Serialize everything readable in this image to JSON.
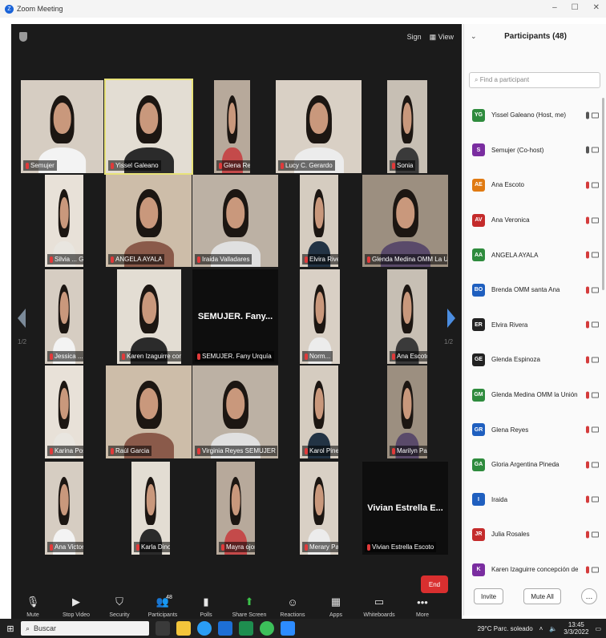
{
  "window": {
    "title": "Zoom Meeting"
  },
  "topbar": {
    "sign_label": "Sign",
    "view_label": "View"
  },
  "tiles": [
    {
      "label": "Semujer"
    },
    {
      "label": "Yissel Galeano"
    },
    {
      "label": "Glena Reyes"
    },
    {
      "label": "Lucy C. Gerardo"
    },
    {
      "label": "Sonia"
    },
    {
      "label": "Silvia ... G"
    },
    {
      "label": "ANGELA AYALA"
    },
    {
      "label": "Iraida Valladares"
    },
    {
      "label": "Elvira Rivera"
    },
    {
      "label": "Glenda Medina OMM La U..."
    },
    {
      "label": "Jessica ... Ana"
    },
    {
      "label": "Karen Izaguirre concepción d..."
    },
    {
      "label": "SEMUJER. Fany Urquía",
      "big_name": "SEMUJER. Fany..."
    },
    {
      "label": "Norm..."
    },
    {
      "label": "Ana Escoto"
    },
    {
      "label": "Karina Posadas"
    },
    {
      "label": "Raúl Garcia"
    },
    {
      "label": "Virginia Reyes SEMUJER"
    },
    {
      "label": "Karol Pineda"
    },
    {
      "label": "Marilyn Padilla"
    },
    {
      "label": "Ana Victoria"
    },
    {
      "label": "Karla Dinora Colindres"
    },
    {
      "label": "Mayra ojorto herrera"
    },
    {
      "label": "Merary Padilla"
    },
    {
      "label": "Vivian Estrella Escoto",
      "big_name": "Vivian Estrella E..."
    }
  ],
  "pager": {
    "left": "1/2",
    "right": "1/2"
  },
  "toolbar": {
    "items": [
      {
        "label": "Mute",
        "icon": "microphone-icon"
      },
      {
        "label": "Stop Video",
        "icon": "video-camera-icon"
      },
      {
        "label": "Security",
        "icon": "shield-icon"
      },
      {
        "label": "Participants",
        "icon": "participants-icon",
        "count": "48"
      },
      {
        "label": "Polls",
        "icon": "poll-icon"
      },
      {
        "label": "Share Screen",
        "icon": "share-screen-icon"
      },
      {
        "label": "Reactions",
        "icon": "reactions-icon"
      },
      {
        "label": "Apps",
        "icon": "apps-icon"
      },
      {
        "label": "Whiteboards",
        "icon": "whiteboard-icon"
      },
      {
        "label": "More",
        "icon": "more-icon"
      }
    ],
    "end_label": "End"
  },
  "panel": {
    "title": "Participants (48)",
    "search_placeholder": "Find a participant",
    "invite_label": "Invite",
    "mute_all_label": "Mute All",
    "participants": [
      {
        "initials": "YG",
        "name": "Yissel Galeano (Host, me)",
        "color": "#2e8b3d",
        "muted": false
      },
      {
        "initials": "S",
        "name": "Semujer (Co-host)",
        "color": "#7a2da0",
        "muted": false
      },
      {
        "initials": "AE",
        "name": "Ana Escoto",
        "color": "#e07a12",
        "muted": true
      },
      {
        "initials": "AV",
        "name": "Ana Veronica",
        "color": "#c42b2b",
        "muted": true
      },
      {
        "initials": "AA",
        "name": "ANGELA AYALA",
        "color": "#2e8b3d",
        "muted": true
      },
      {
        "initials": "BO",
        "name": "Brenda OMM santa Ana",
        "color": "#1f5fbf",
        "muted": true
      },
      {
        "initials": "ER",
        "name": "Elvira Rivera",
        "color": "#222222",
        "muted": true
      },
      {
        "initials": "GE",
        "name": "Glenda Espinoza",
        "color": "#222222",
        "muted": true
      },
      {
        "initials": "GM",
        "name": "Glenda Medina OMM la Unión",
        "color": "#2e8b3d",
        "muted": true
      },
      {
        "initials": "GR",
        "name": "Glena Reyes",
        "color": "#1f5fbf",
        "muted": true
      },
      {
        "initials": "GA",
        "name": "Gloria Argentina Pineda",
        "color": "#2e8b3d",
        "muted": true
      },
      {
        "initials": "I",
        "name": "Iraida",
        "color": "#1f5fbf",
        "muted": true
      },
      {
        "initials": "JR",
        "name": "Julia Rosales",
        "color": "#c42b2b",
        "muted": true
      },
      {
        "initials": "K",
        "name": "Karen Izaguirre concepción del...",
        "color": "#7a2da0",
        "muted": true
      }
    ]
  },
  "taskbar": {
    "search_label": "Buscar",
    "weather": "29°C Parc. soleado",
    "time": "13:45",
    "date": "3/3/2022"
  }
}
